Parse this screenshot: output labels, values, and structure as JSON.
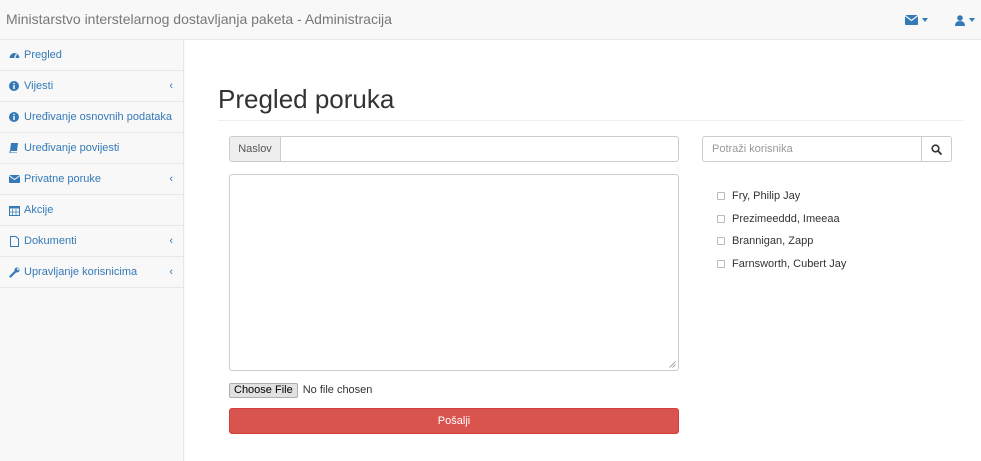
{
  "navbar": {
    "brand": "Ministarstvo interstelarnog dostavljanja paketa - Administracija",
    "icons": [
      "envelope-icon",
      "user-icon"
    ]
  },
  "sidebar": {
    "items": [
      {
        "label": "Pregled",
        "icon": "dashboard-icon",
        "has_submenu": false
      },
      {
        "label": "Vijesti",
        "icon": "info-icon",
        "has_submenu": true
      },
      {
        "label": "Uređivanje osnovnih podataka",
        "icon": "info-icon",
        "has_submenu": false
      },
      {
        "label": "Uređivanje povijesti",
        "icon": "book-icon",
        "has_submenu": false
      },
      {
        "label": "Privatne poruke",
        "icon": "envelope-icon",
        "has_submenu": true
      },
      {
        "label": "Akcije",
        "icon": "calendar-icon",
        "has_submenu": false
      },
      {
        "label": "Dokumenti",
        "icon": "file-icon",
        "has_submenu": true
      },
      {
        "label": "Upravljanje korisnicima",
        "icon": "wrench-icon",
        "has_submenu": true
      }
    ]
  },
  "main": {
    "title": "Pregled poruka",
    "subject_addon": "Naslov",
    "subject_value": "",
    "message_value": "",
    "file_button": "Choose File",
    "file_status": "No file chosen",
    "send_label": "Pošalji",
    "search_placeholder": "Potraži korisnika",
    "users": [
      "Fry, Philip Jay",
      "Prezimeeddd, Imeeaa",
      "Brannigan, Zapp",
      "Farnsworth, Cubert Jay"
    ]
  },
  "colors": {
    "link": "#337ab7",
    "danger": "#d9534f",
    "navbar_bg": "#f8f8f8"
  }
}
